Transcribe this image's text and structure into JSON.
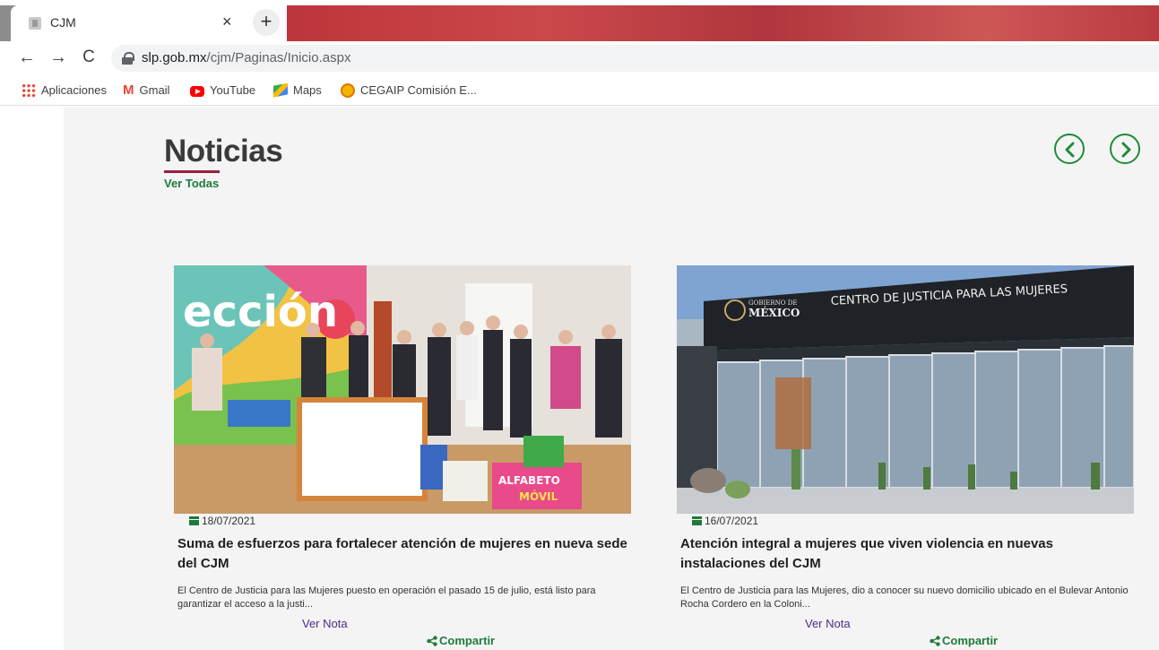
{
  "browser": {
    "tab": {
      "title": "CJM",
      "close": "×"
    },
    "new_tab": "+",
    "nav": {
      "back": "←",
      "forward": "→",
      "reload": "C"
    },
    "url": {
      "host": "slp.gob.mx",
      "path": "/cjm/Paginas/Inicio.aspx"
    },
    "bookmarks": [
      {
        "label": "Aplicaciones",
        "icon": "apps-icon"
      },
      {
        "label": "Gmail",
        "icon": "gmail-icon",
        "glyph": "M"
      },
      {
        "label": "YouTube",
        "icon": "youtube-icon"
      },
      {
        "label": "Maps",
        "icon": "maps-icon"
      },
      {
        "label": "CEGAIP Comisión E...",
        "icon": "cegaip-icon"
      }
    ]
  },
  "news": {
    "title": "Noticias",
    "see_all": "Ver Todas",
    "cards": [
      {
        "date": "18/07/2021",
        "title": "Suma de esfuerzos para fortalecer atención de mujeres en nueva sede del CJM",
        "excerpt": "El Centro de Justicia para las Mujeres puesto en operación el pasado 15 de julio, está listo para garantizar el acceso a la justi...",
        "read_more": "Ver Nota",
        "share": "Compartir",
        "image_text": "ección",
        "image_sign": [
          "ALFABETO",
          "MÓVIL"
        ]
      },
      {
        "date": "16/07/2021",
        "title": "Atención integral a mujeres que viven violencia en nuevas instalaciones del CJM",
        "excerpt": "El Centro de Justicia para las Mujeres, dio a conocer su nuevo domicilio ubicado en el Bulevar Antonio Rocha Cordero en la Coloni...",
        "read_more": "Ver Nota",
        "share": "Compartir",
        "image_sign": "CENTRO DE JUSTICIA PARA LAS MUJERES",
        "image_logo": [
          "GOBIERNO DE",
          "MÉXICO"
        ]
      }
    ]
  },
  "colors": {
    "accent_green": "#1e7a3a",
    "underline_red": "#9b1d3a",
    "link_purple": "#4b2d86",
    "page_bg": "#f4f4f4"
  }
}
